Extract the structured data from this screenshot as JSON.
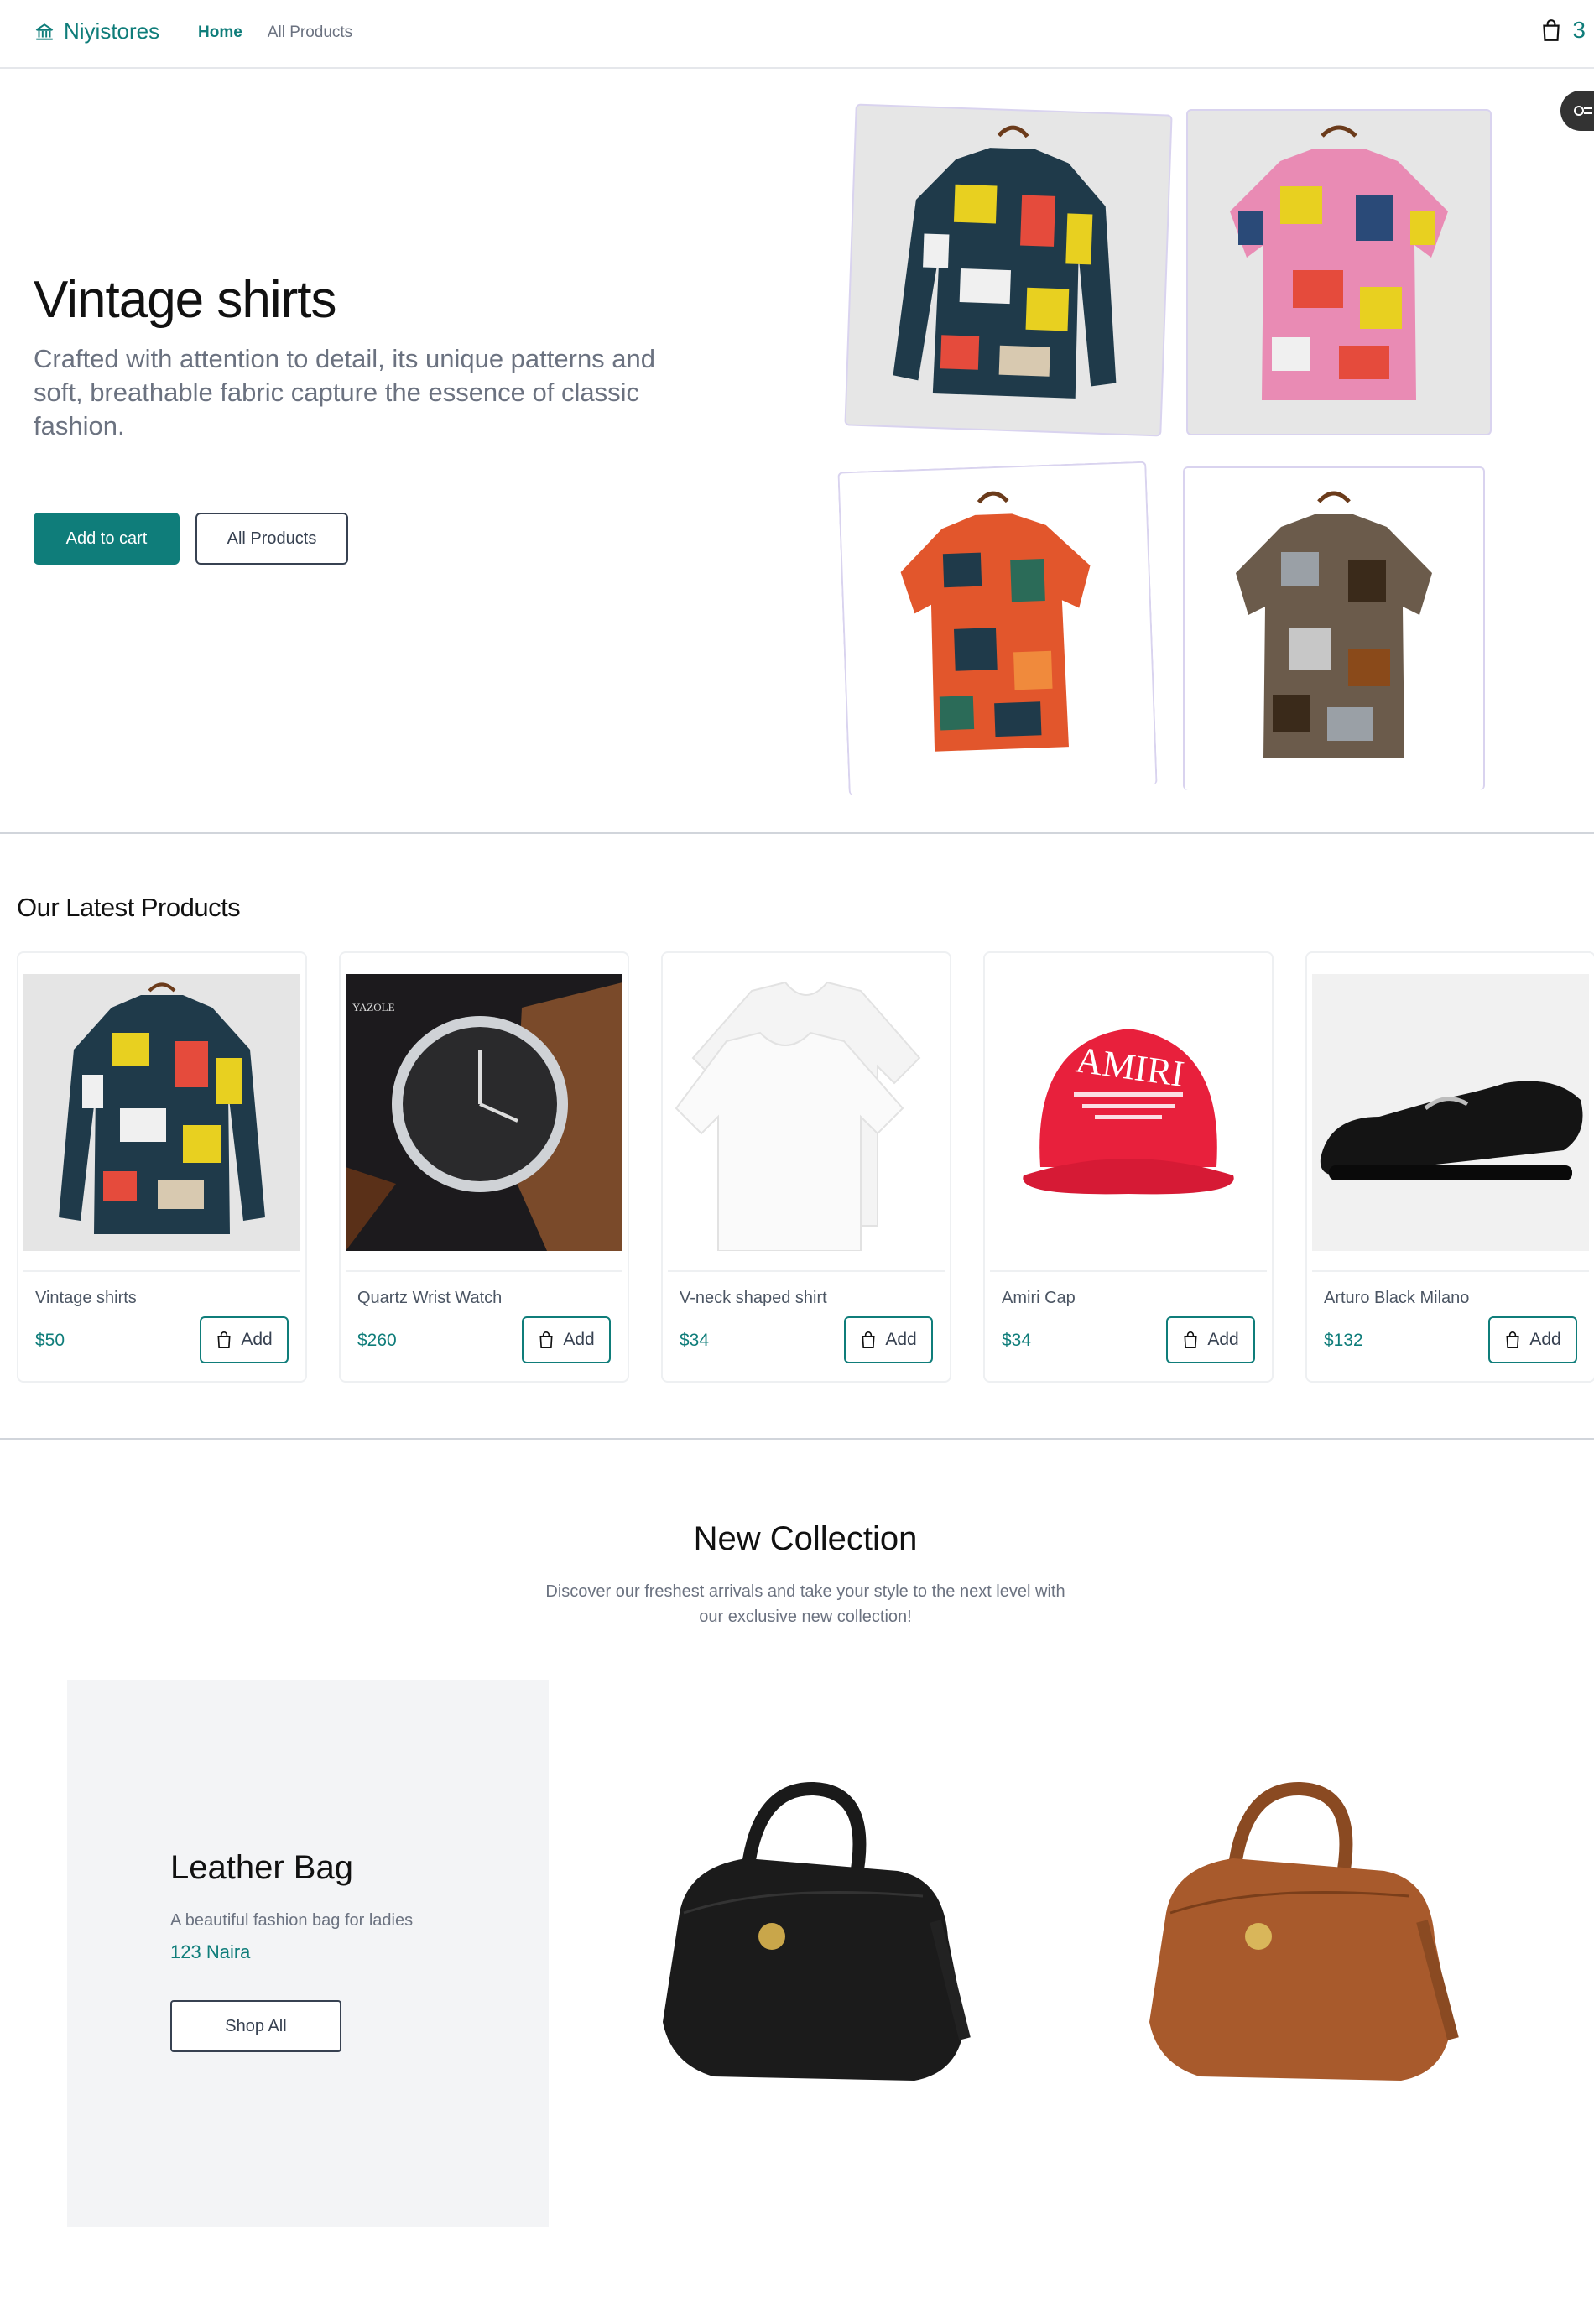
{
  "header": {
    "brand": "Niyistores",
    "nav": [
      {
        "label": "Home"
      },
      {
        "label": "All Products"
      }
    ],
    "cart_count": "3"
  },
  "hero": {
    "title": "Vintage shirts",
    "description": "Crafted with attention to detail, its unique patterns and soft, breathable fabric capture the essence of classic fashion.",
    "primary_button": "Add to cart",
    "secondary_button": "All Products"
  },
  "latest": {
    "title": "Our Latest Products",
    "add_label": "Add",
    "products": [
      {
        "name": "Vintage shirts",
        "price": "$50"
      },
      {
        "name": "Quartz Wrist Watch",
        "price": "$260"
      },
      {
        "name": "V-neck shaped shirt",
        "price": "$34"
      },
      {
        "name": "Amiri Cap",
        "price": "$34"
      },
      {
        "name": "Arturo Black Milano",
        "price": "$132"
      }
    ]
  },
  "collection": {
    "title": "New Collection",
    "description": "Discover our freshest arrivals and take your style to the next level with our exclusive new collection!",
    "feature_title": "Leather Bag",
    "feature_desc": "A beautiful fashion bag for ladies",
    "feature_price": "123 Naira",
    "button": "Shop All"
  },
  "product_images": {
    "watch_brand": "YAZOLE",
    "cap_text": "AMIRI"
  },
  "colors": {
    "accent": "#0f7d7a",
    "muted_text": "#6b7280",
    "panel_bg": "#f3f4f6"
  }
}
